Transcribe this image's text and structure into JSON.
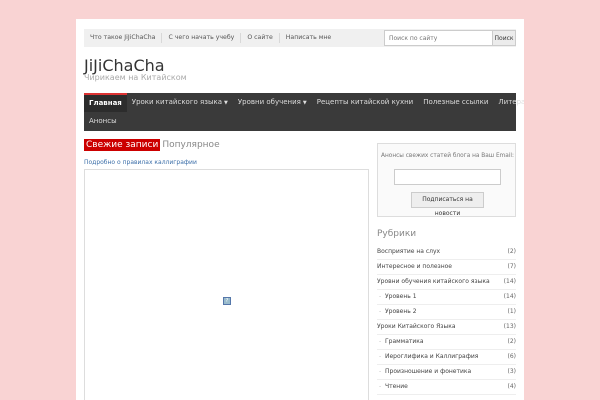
{
  "topnav": [
    "Что такое JiJiChaCha",
    "С чего начать учебу",
    "О сайте",
    "Написать мне"
  ],
  "search": {
    "placeholder": "Поиск по сайту",
    "button": "Поиск"
  },
  "site": {
    "title": "JiJiChaCha",
    "description": "Чирикаем на Китайском"
  },
  "mainnav": {
    "row1": [
      {
        "label": "Главная",
        "active": true
      },
      {
        "label": "Уроки китайского языка",
        "caret": true
      },
      {
        "label": "Уровни обучения",
        "caret": true
      },
      {
        "label": "Рецепты китайской кухни"
      },
      {
        "label": "Полезные ссылки"
      },
      {
        "label": "Литература"
      }
    ],
    "row2": [
      {
        "label": "Анонсы"
      }
    ]
  },
  "tabs": {
    "active": "Свежие записи",
    "inactive": "Популярное"
  },
  "post": {
    "link": "Подробно о правилах каллиграфии",
    "broken_icon": "?"
  },
  "subscribe": {
    "label": "Анонсы свежих статей блога на Ваш Email:",
    "button": "Подписаться на новости"
  },
  "categories": {
    "title": "Рубрики",
    "items": [
      {
        "name": "Восприятие на слух",
        "count": "(2)",
        "sub": false
      },
      {
        "name": "Интересное и полезное",
        "count": "(7)",
        "sub": false
      },
      {
        "name": "Уровни обучения китайского языка",
        "count": "(14)",
        "sub": false
      },
      {
        "name": "Уровень 1",
        "count": "(14)",
        "sub": true
      },
      {
        "name": "Уровень 2",
        "count": "(1)",
        "sub": true
      },
      {
        "name": "Уроки Китайского Языка",
        "count": "(13)",
        "sub": false
      },
      {
        "name": "Грамматика",
        "count": "(2)",
        "sub": true
      },
      {
        "name": "Иероглифика и Каллиграфия",
        "count": "(6)",
        "sub": true
      },
      {
        "name": "Произношение и фонетика",
        "count": "(3)",
        "sub": true
      },
      {
        "name": "Чтение",
        "count": "(4)",
        "sub": true
      }
    ]
  }
}
